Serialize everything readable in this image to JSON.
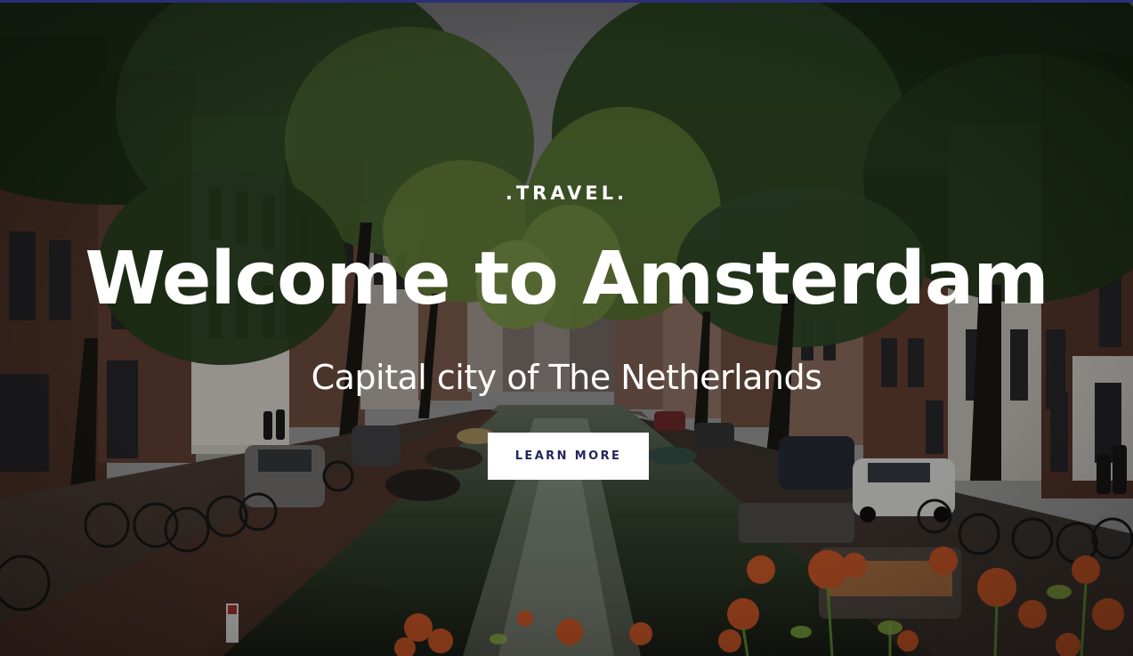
{
  "hero": {
    "eyebrow": ".TRAVEL.",
    "title": "Welcome to Amsterdam",
    "subtitle": "Capital city of The Netherlands",
    "cta_label": "LEARN MORE"
  },
  "colors": {
    "top_accent": "#2b2f77",
    "button_bg": "#ffffff",
    "button_text": "#23265e",
    "text": "#ffffff",
    "overlay": "rgba(0,0,0,0.35)"
  },
  "background": {
    "scene": "amsterdam-canal-photo",
    "elements": [
      "canal-water",
      "tree-canopy",
      "brick-canal-houses",
      "parked-bicycles",
      "parked-cars",
      "moored-boats",
      "orange-flowers"
    ]
  }
}
